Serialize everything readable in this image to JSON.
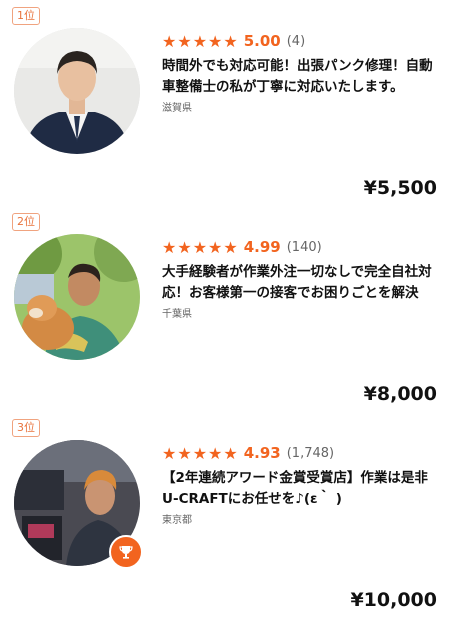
{
  "listings": [
    {
      "rank": "1位",
      "stars_glyph": "★★★★★",
      "rating": "5.00",
      "review_count": "(4)",
      "title": "時間外でも対応可能！出張パンク修理！自動車整備士の私が丁寧に対応いたします。",
      "prefecture": "滋賀県",
      "price": "¥5,500"
    },
    {
      "rank": "2位",
      "stars_glyph": "★★★★★",
      "rating": "4.99",
      "review_count": "(140)",
      "title": "大手経験者が作業外注一切なしで完全自社対応！お客様第一の接客でお困りごとを解決",
      "prefecture": "千葉県",
      "price": "¥8,000"
    },
    {
      "rank": "3位",
      "stars_glyph": "★★★★★",
      "rating": "4.93",
      "review_count": "(1,748)",
      "title": "【2年連続アワード金賞受賞店】作業は是非U-CRAFTにお任せを♪(ε｀ )",
      "prefecture": "東京都",
      "price": "¥10,000",
      "badge_icon": "trophy-icon"
    }
  ],
  "colors": {
    "accent": "#f2641f",
    "rank_border": "#f0a37f"
  }
}
